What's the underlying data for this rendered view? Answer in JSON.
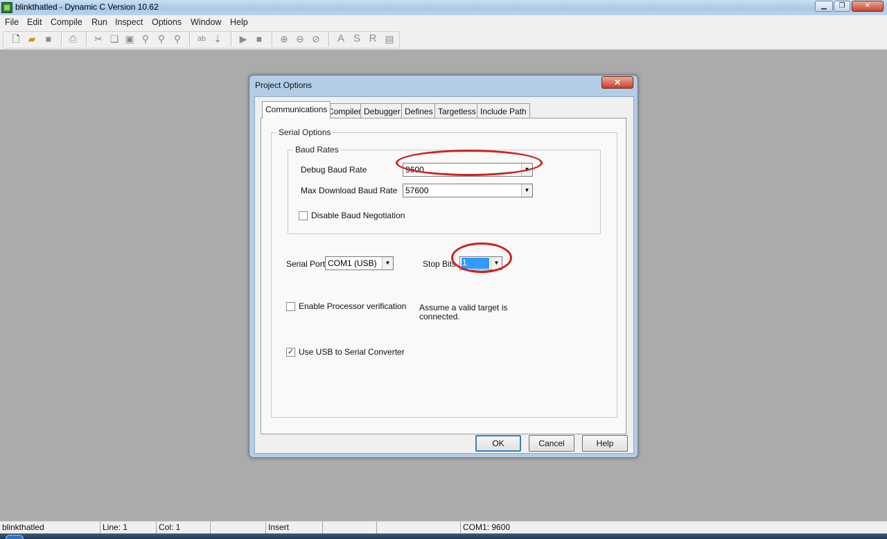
{
  "window": {
    "title": "blinkthatled - Dynamic C Version 10.62",
    "min_glyph": "▁",
    "max_glyph": "❐",
    "close_glyph": "✕"
  },
  "menu": [
    "File",
    "Edit",
    "Compile",
    "Run",
    "Inspect",
    "Options",
    "Window",
    "Help"
  ],
  "toolbar": {
    "icons": [
      "new-file-icon",
      "open-folder-icon",
      "save-icon",
      "print-icon",
      "cut-icon",
      "copy-icon",
      "paste-icon",
      "find-icon",
      "find-next-icon",
      "replace-icon",
      "abl-icon",
      "step-icon",
      "run-icon",
      "stop-icon",
      "zoom-in-icon",
      "zoom-out-icon",
      "zoom-reset-icon"
    ],
    "letter_buttons": [
      "A",
      "S",
      "R"
    ]
  },
  "dialog": {
    "title": "Project Options",
    "close_glyph": "✕",
    "tabs": [
      "Communications",
      "Compiler",
      "Debugger",
      "Defines",
      "Targetless",
      "Include Path"
    ],
    "active_tab": "Communications",
    "serial_options": {
      "title": "Serial Options",
      "baud_rates": {
        "title": "Baud Rates",
        "debug_label": "Debug Baud Rate",
        "debug_value": "9600",
        "max_download_label": "Max Download Baud Rate",
        "max_download_value": "57600",
        "disable_negotiation_label": "Disable Baud Negotiation",
        "disable_negotiation_checked": false
      },
      "serial_port_label": "Serial Port",
      "serial_port_value": "COM1 (USB)",
      "stop_bits_label": "Stop Bits",
      "stop_bits_value": "1",
      "processor_verification_label": "Enable Processor verification",
      "processor_verification_checked": false,
      "assume_text_line1": "Assume a valid target is",
      "assume_text_line2": "connected.",
      "usb_label": "Use USB to Serial Converter",
      "usb_checked": true,
      "check_glyph": "✓"
    },
    "buttons": {
      "ok": "OK",
      "cancel": "Cancel",
      "help": "Help"
    }
  },
  "annotation_color": "#d0201f",
  "status_bar": {
    "file": "blinkthatled",
    "line": "Line: 1",
    "col": "Col: 1",
    "mode": "Insert",
    "port": "COM1: 9600"
  }
}
